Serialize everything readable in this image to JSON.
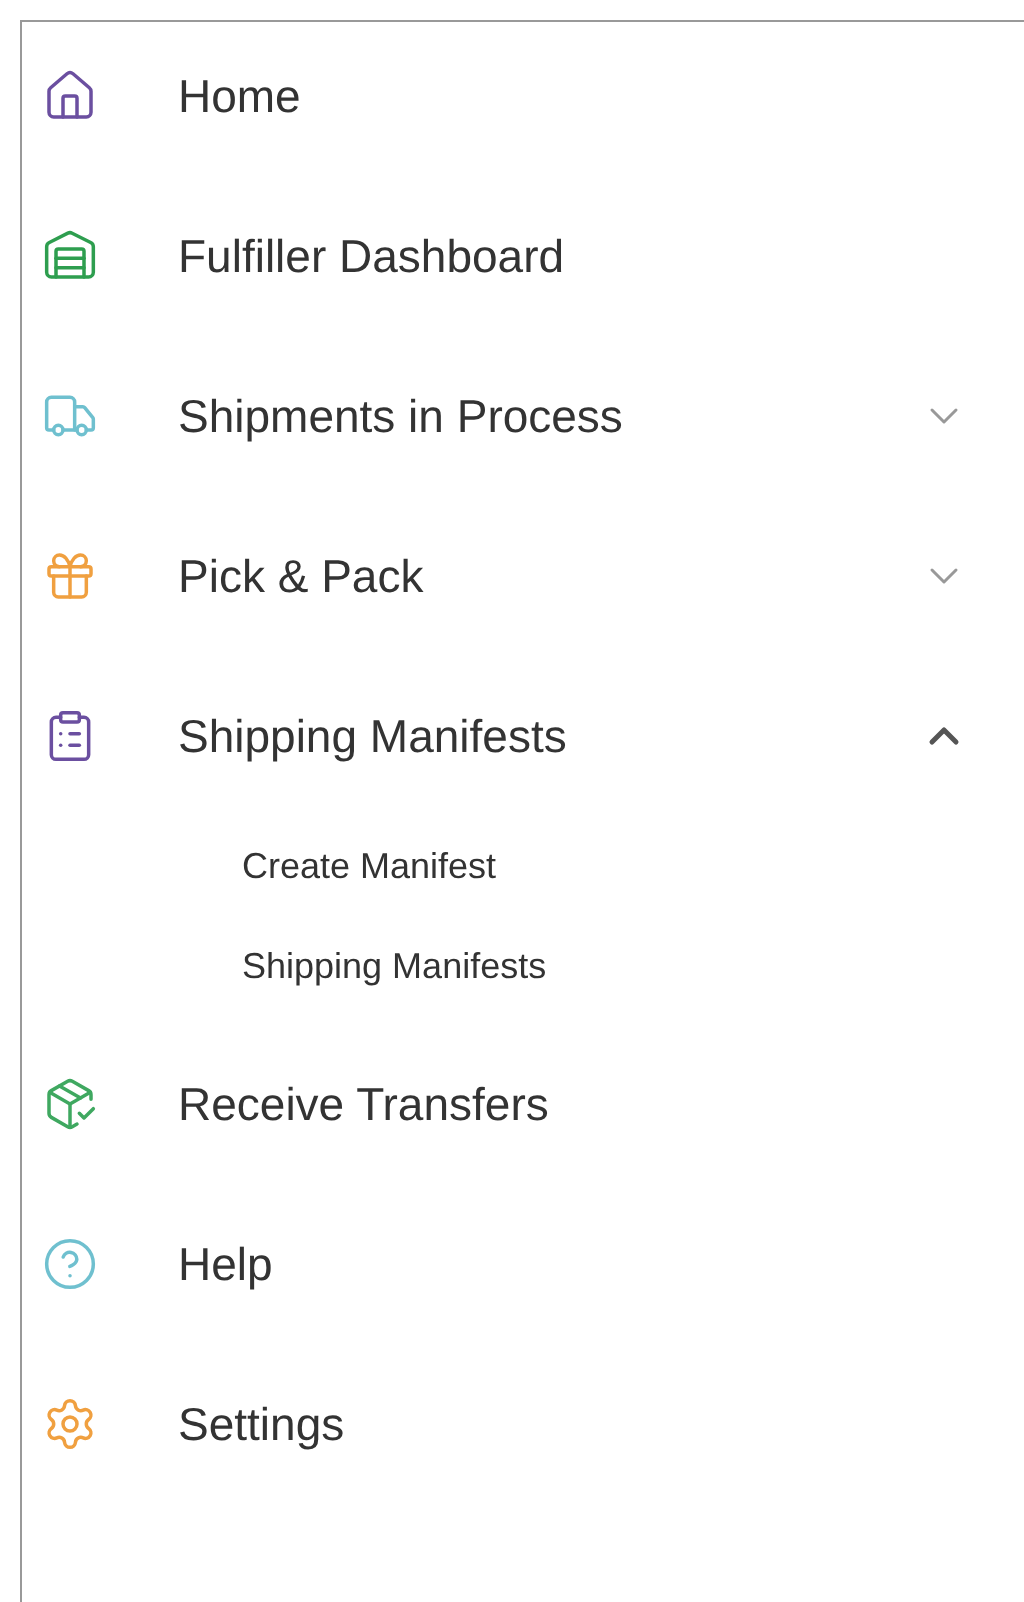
{
  "nav": [
    {
      "kind": "home",
      "label": "Home"
    },
    {
      "kind": "warehouse",
      "label": "Fulfiller Dashboard"
    },
    {
      "kind": "truck",
      "label": "Shipments in Process",
      "expanded": false
    },
    {
      "kind": "gift",
      "label": "Pick & Pack",
      "expanded": false
    },
    {
      "kind": "clipboard",
      "label": "Shipping Manifests",
      "expanded": true,
      "children": [
        {
          "label": "Create Manifest"
        },
        {
          "label": "Shipping Manifests"
        }
      ]
    },
    {
      "kind": "transfer",
      "label": "Receive Transfers"
    },
    {
      "kind": "help",
      "label": "Help"
    },
    {
      "kind": "settings",
      "label": "Settings"
    }
  ]
}
